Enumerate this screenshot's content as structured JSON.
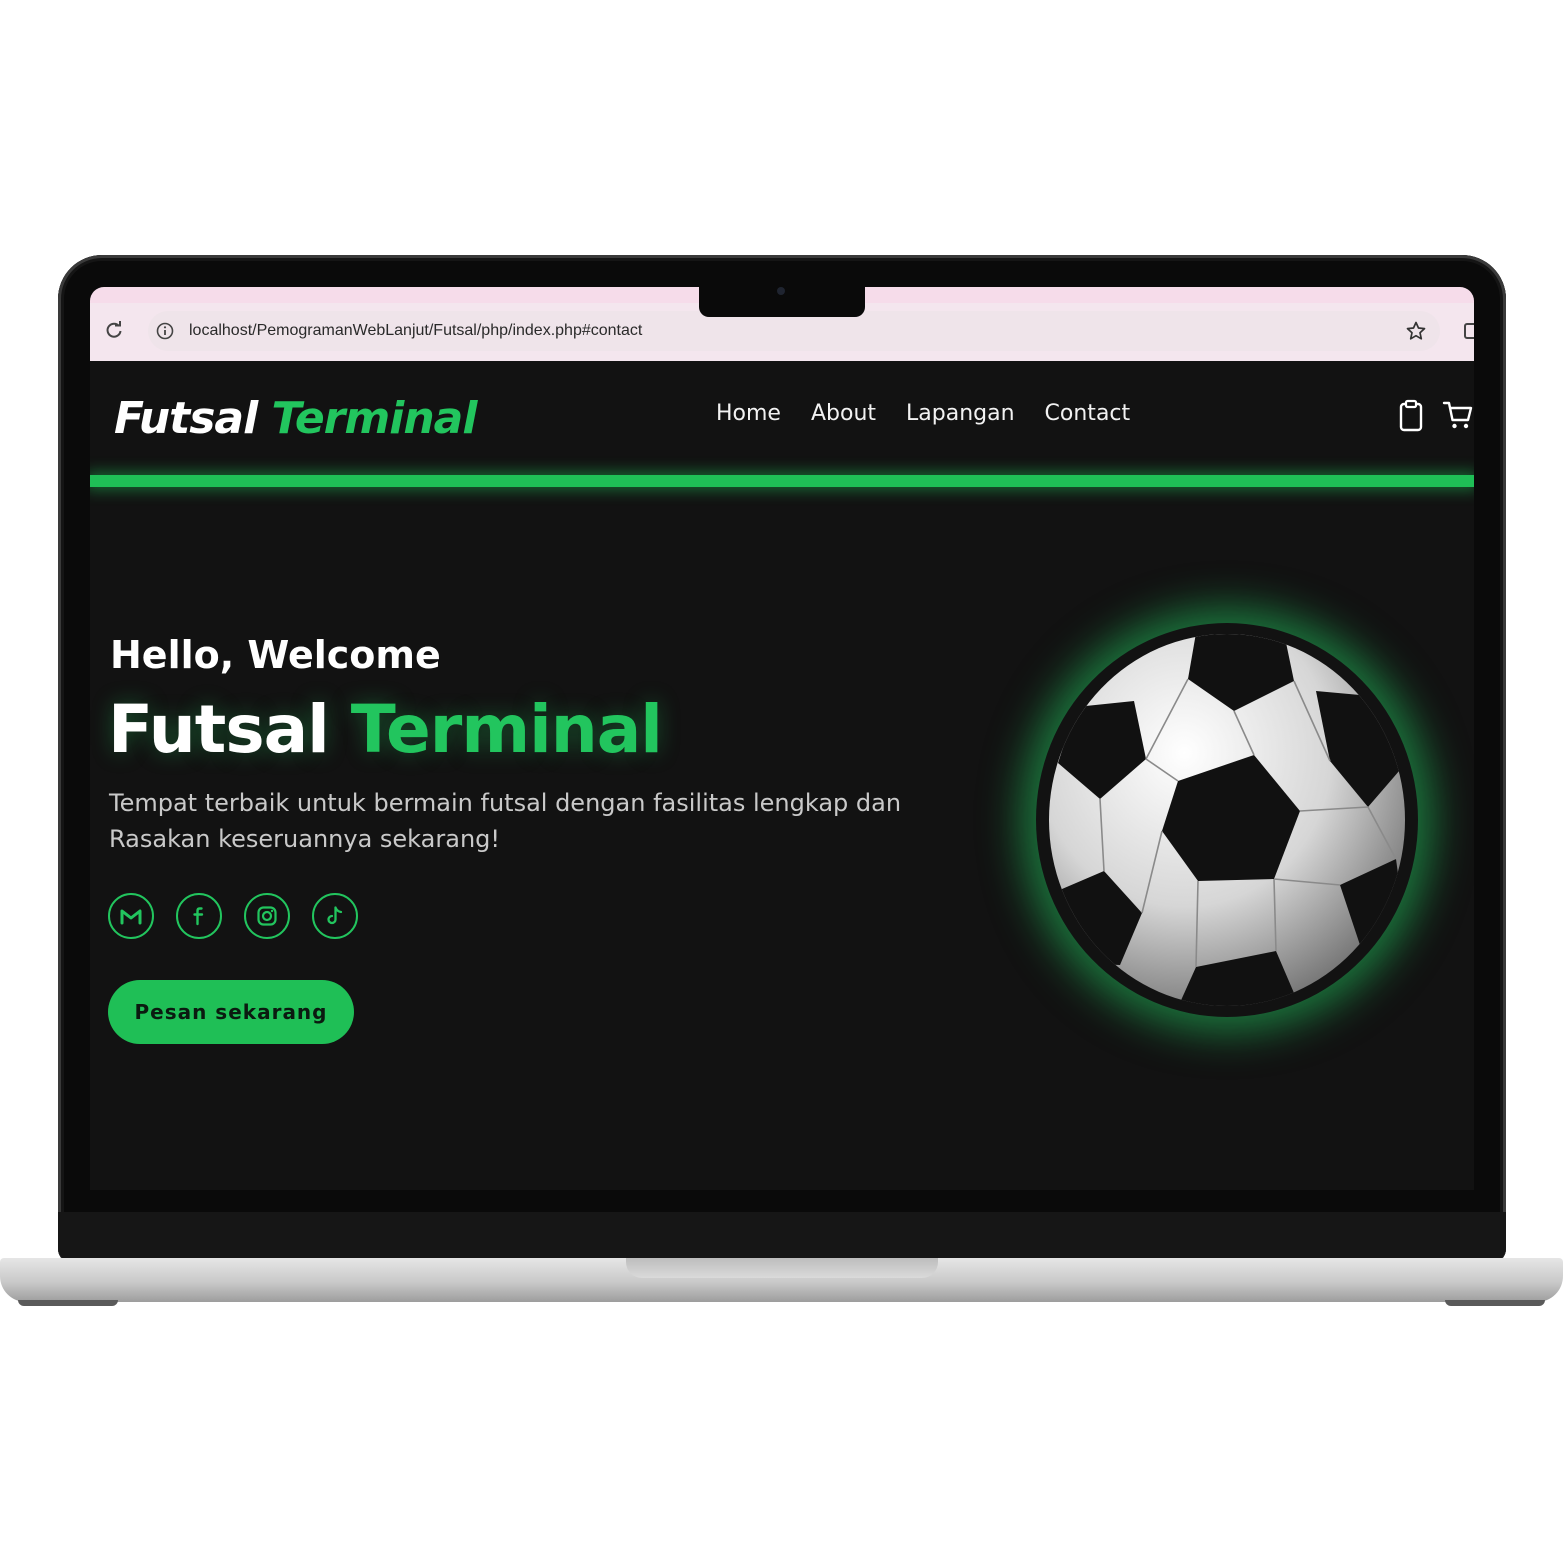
{
  "browser": {
    "url": "localhost/PemogramanWebLanjut/Futsal/php/index.php#contact"
  },
  "header": {
    "brand_primary": "Futsal",
    "brand_accent": "Terminal",
    "nav": [
      "Home",
      "About",
      "Lapangan",
      "Contact"
    ]
  },
  "hero": {
    "greeting": "Hello, Welcome",
    "title_primary": "Futsal",
    "title_accent": "Terminal",
    "description_line1": "Tempat terbaik untuk bermain futsal dengan fasilitas lengkap dan",
    "description_line2": "Rasakan keseruannya sekarang!",
    "socials": [
      "gmail-icon",
      "facebook-icon",
      "instagram-icon",
      "tiktok-icon"
    ],
    "cta_label": "Pesan sekarang"
  },
  "colors": {
    "accent": "#22c55e",
    "background": "#121212",
    "text": "#ffffff"
  }
}
